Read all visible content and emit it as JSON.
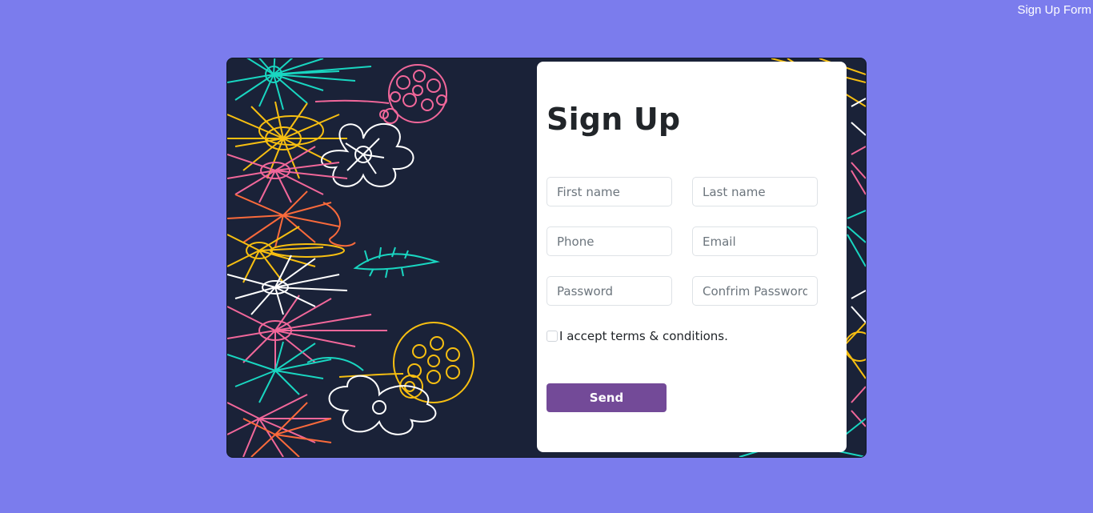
{
  "header": {
    "title": "Sign Up Form"
  },
  "form": {
    "title": "Sign Up",
    "first_name_placeholder": "First name",
    "last_name_placeholder": "Last name",
    "phone_placeholder": "Phone",
    "email_placeholder": "Email",
    "password_placeholder": "Password",
    "confirm_password_placeholder": "Confrim Password",
    "terms_label": "I accept terms & conditions.",
    "terms_checked": false,
    "send_label": "Send"
  },
  "colors": {
    "page_background": "#7b7ced",
    "card_background": "#1a2238",
    "button": "#734a98",
    "flower_teal": "#19d6c1",
    "flower_pink": "#f1679a",
    "flower_yellow": "#f7bf11",
    "flower_orange": "#fa6a3b",
    "flower_white": "#ffffff"
  },
  "icons": {
    "decoration": "floral-illustration"
  }
}
